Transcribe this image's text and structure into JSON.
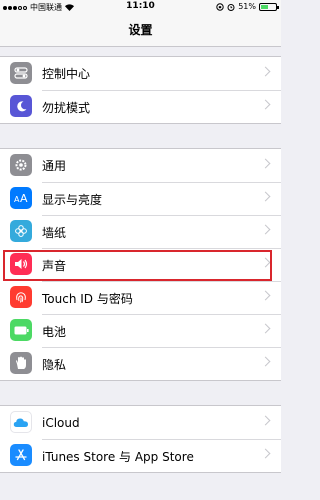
{
  "status_bar": {
    "carrier": "中国联通",
    "time": "11:10",
    "battery": "51%",
    "battery_level": 0.51
  },
  "nav": {
    "title": "设置"
  },
  "group1": [
    {
      "label": "控制中心",
      "icon": "control-center-icon",
      "color": "#8e8e93"
    },
    {
      "label": "勿扰模式",
      "icon": "moon-icon",
      "color": "#5856d6"
    }
  ],
  "group2": [
    {
      "label": "通用",
      "icon": "gear-icon",
      "color": "#8e8e93"
    },
    {
      "label": "显示与亮度",
      "icon": "text-size-icon",
      "color": "#007aff"
    },
    {
      "label": "墙纸",
      "icon": "flower-icon",
      "color": "#34aadc"
    },
    {
      "label": "声音",
      "icon": "speaker-icon",
      "color": "#ff2d55"
    },
    {
      "label": "Touch ID 与密码",
      "icon": "fingerprint-icon",
      "color": "#ff3b30"
    },
    {
      "label": "电池",
      "icon": "battery-icon",
      "color": "#4cd964"
    },
    {
      "label": "隐私",
      "icon": "hand-icon",
      "color": "#8e8e93"
    }
  ],
  "group3": [
    {
      "label": "iCloud",
      "icon": "cloud-icon",
      "color": "#ffffff"
    },
    {
      "label": "iTunes Store 与 App Store",
      "icon": "app-store-icon",
      "color": "#1a8cff"
    }
  ]
}
